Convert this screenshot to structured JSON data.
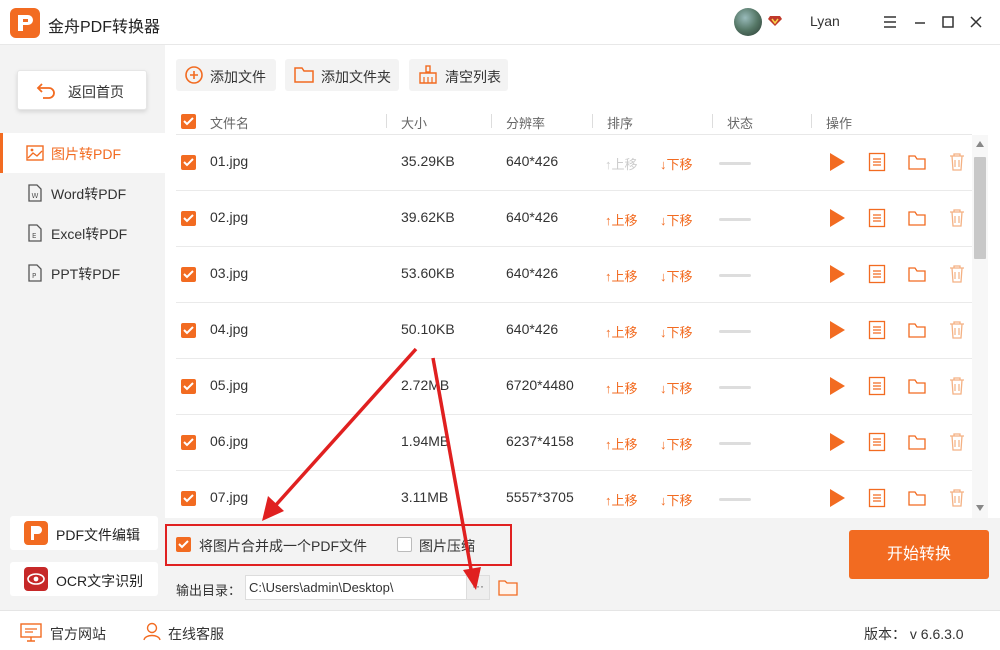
{
  "app": {
    "title": "金舟PDF转换器",
    "username": "Lyan"
  },
  "sidebar": {
    "back_label": "返回首页",
    "items": [
      {
        "label": "图片转PDF",
        "active": true
      },
      {
        "label": "Word转PDF",
        "active": false
      },
      {
        "label": "Excel转PDF",
        "active": false
      },
      {
        "label": "PPT转PDF",
        "active": false
      }
    ],
    "tools": [
      {
        "label": "PDF文件编辑"
      },
      {
        "label": "OCR文字识别"
      }
    ]
  },
  "toolbar": {
    "add_file": "添加文件",
    "add_folder": "添加文件夹",
    "clear_list": "清空列表"
  },
  "table": {
    "headers": [
      "文件名",
      "大小",
      "分辨率",
      "排序",
      "状态",
      "操作"
    ],
    "move_up": "上移",
    "move_down": "下移",
    "rows": [
      {
        "name": "01.jpg",
        "size": "35.29KB",
        "resolution": "640*426"
      },
      {
        "name": "02.jpg",
        "size": "39.62KB",
        "resolution": "640*426"
      },
      {
        "name": "03.jpg",
        "size": "53.60KB",
        "resolution": "640*426"
      },
      {
        "name": "04.jpg",
        "size": "50.10KB",
        "resolution": "640*426"
      },
      {
        "name": "05.jpg",
        "size": "2.72MB",
        "resolution": "6720*4480"
      },
      {
        "name": "06.jpg",
        "size": "1.94MB",
        "resolution": "6237*4158"
      },
      {
        "name": "07.jpg",
        "size": "3.11MB",
        "resolution": "5557*3705"
      }
    ]
  },
  "options": {
    "merge_label": "将图片合并成一个PDF文件",
    "merge_checked": true,
    "compress_label": "图片压缩",
    "compress_checked": false
  },
  "output": {
    "label": "输出目录：",
    "path": "C:\\Users\\admin\\Desktop\\",
    "browse": "···"
  },
  "start_label": "开始转换",
  "statusbar": {
    "website": "官方网站",
    "service": "在线客服",
    "version": "版本： v 6.6.3.0"
  },
  "colors": {
    "accent": "#f26b21",
    "annotation": "#e02020"
  }
}
